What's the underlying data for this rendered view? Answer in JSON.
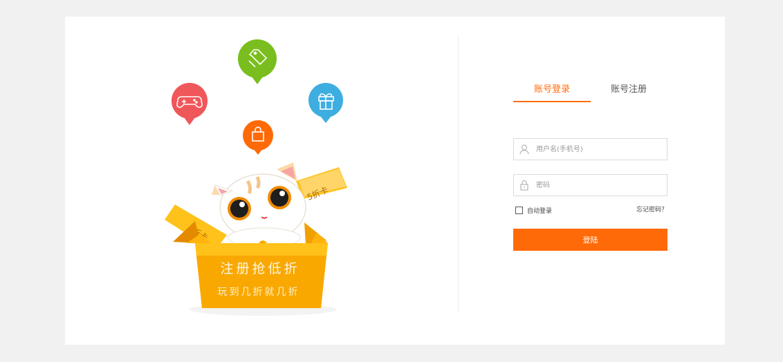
{
  "promo": {
    "headline": "注册抢低折",
    "subline": "玩到几折就几折",
    "card_4": "4折卡",
    "card_5": "5折卡"
  },
  "tabs": [
    {
      "label": "账号登录",
      "active": true
    },
    {
      "label": "账号注册",
      "active": false
    }
  ],
  "form": {
    "username_placeholder": "用户名(手机号)",
    "username_value": "",
    "password_placeholder": "密码",
    "password_value": "",
    "remember_label": "自动登录",
    "remember_checked": false,
    "forgot_label": "忘记密码？",
    "submit_label": "登陆"
  },
  "colors": {
    "accent": "#ff6a08",
    "bubble_game": "#f0575b",
    "bubble_tag": "#79be1e",
    "bubble_gift": "#3eaee0",
    "bubble_bag": "#ff6a08"
  }
}
